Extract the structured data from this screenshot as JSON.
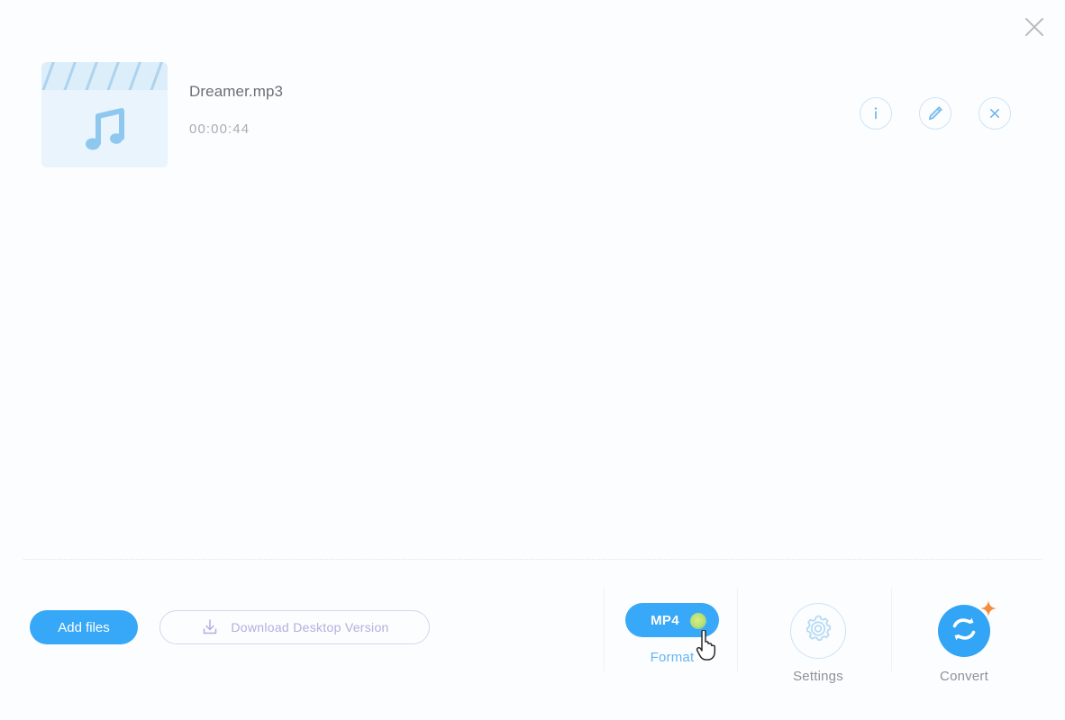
{
  "window": {
    "close_icon": "close-icon"
  },
  "file": {
    "name": "Dreamer.mp3",
    "duration": "00:00:44",
    "thumbnail_icon": "music-note-clapperboard-icon",
    "actions": [
      {
        "name": "info",
        "icon": "info-icon",
        "label": "i"
      },
      {
        "name": "edit",
        "icon": "pencil-icon"
      },
      {
        "name": "remove",
        "icon": "close-circle-icon"
      }
    ]
  },
  "toolbar": {
    "add_files_label": "Add files",
    "download_label": "Download Desktop Version",
    "download_icon": "download-icon",
    "format": {
      "value": "MP4",
      "label": "Format"
    },
    "settings": {
      "label": "Settings",
      "icon": "gear-icon"
    },
    "convert": {
      "label": "Convert",
      "icon": "convert-sync-icon"
    }
  },
  "colors": {
    "accent_blue": "#37a7f7",
    "light_blue": "#64b5f5",
    "icon_outline": "#cfe4f6",
    "thumb_bg": "#e9f4fd",
    "muted_text": "#8e9296",
    "file_name_text": "#6b6f73",
    "duration_text": "#a9adb2",
    "download_border": "#d8d4ee",
    "download_text": "#b3aede",
    "sparkle_orange": "#f58c3c",
    "glow_green": "#b5df72",
    "background": "#fcfdfe"
  }
}
